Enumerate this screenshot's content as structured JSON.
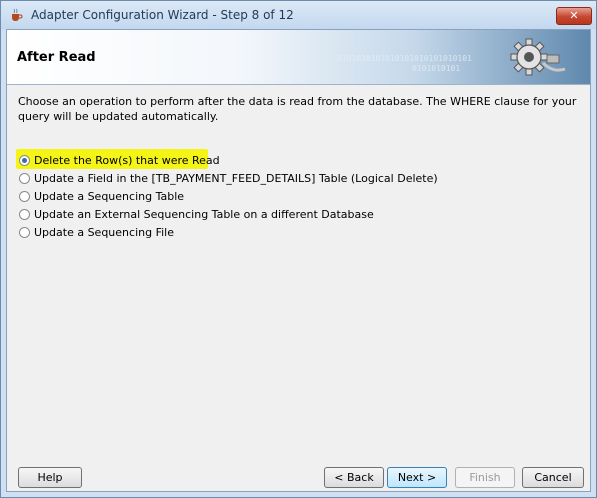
{
  "window": {
    "title": "Adapter Configuration Wizard - Step 8 of 12",
    "close_label": "✕"
  },
  "banner": {
    "title": "After Read",
    "binary_text": "0101010101010101010101010101",
    "binary_text2": "0101010101"
  },
  "description": "Choose an operation to perform after the data is read from the database.  The WHERE clause for your query will be updated automatically.",
  "options": [
    {
      "label": "Delete the Row(s) that were Read",
      "selected": true
    },
    {
      "label": "Update a Field in the [TB_PAYMENT_FEED_DETAILS] Table (Logical Delete)",
      "selected": false
    },
    {
      "label": "Update a Sequencing Table",
      "selected": false
    },
    {
      "label": "Update an External Sequencing Table on a different Database",
      "selected": false
    },
    {
      "label": "Update a Sequencing File",
      "selected": false
    }
  ],
  "buttons": {
    "help": "Help",
    "back": "< Back",
    "next": "Next >",
    "finish": "Finish",
    "cancel": "Cancel"
  },
  "colors": {
    "highlight": "#f4f416",
    "accent": "#3c7fb1",
    "close": "#c7462f"
  }
}
